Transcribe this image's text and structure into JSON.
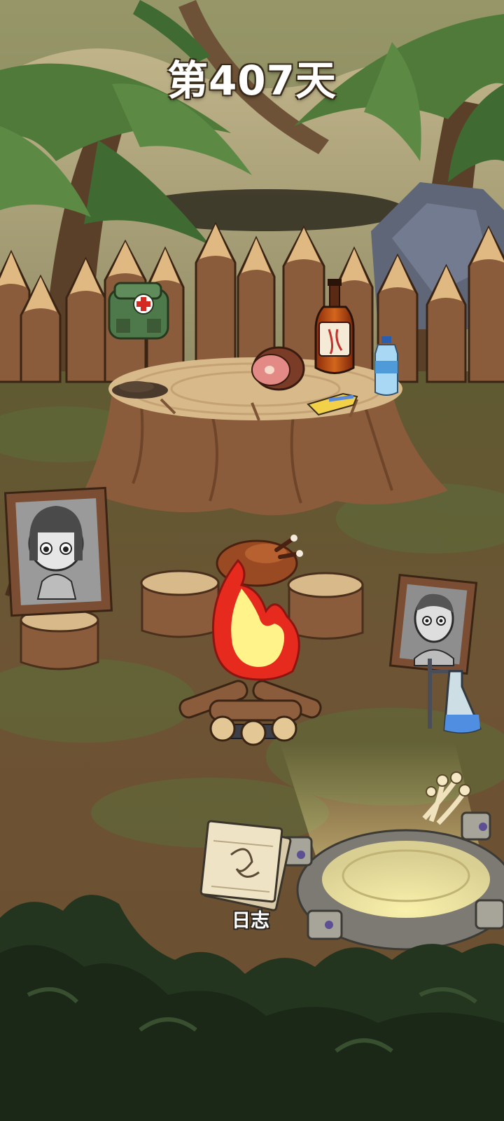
{
  "hud": {
    "day_counter": "第407天"
  },
  "journal": {
    "label": "日志"
  },
  "items": [
    {
      "name": "first-aid-kit"
    },
    {
      "name": "whiskey-bottle"
    },
    {
      "name": "water-bottle"
    },
    {
      "name": "ham"
    },
    {
      "name": "cheese-bar"
    },
    {
      "name": "dirt-pile"
    },
    {
      "name": "roast-chicken"
    },
    {
      "name": "campfire"
    },
    {
      "name": "portrait-girl"
    },
    {
      "name": "portrait-man"
    },
    {
      "name": "chemistry-flask"
    },
    {
      "name": "mushrooms"
    },
    {
      "name": "stone-well"
    }
  ],
  "colors": {
    "fire_outer": "#e62a1d",
    "fire_inner": "#fff38a",
    "foliage": "#4f7a3a",
    "dark_foliage": "#24351f",
    "ground": "#7a5a3a",
    "stump": "#9a6a4a"
  }
}
